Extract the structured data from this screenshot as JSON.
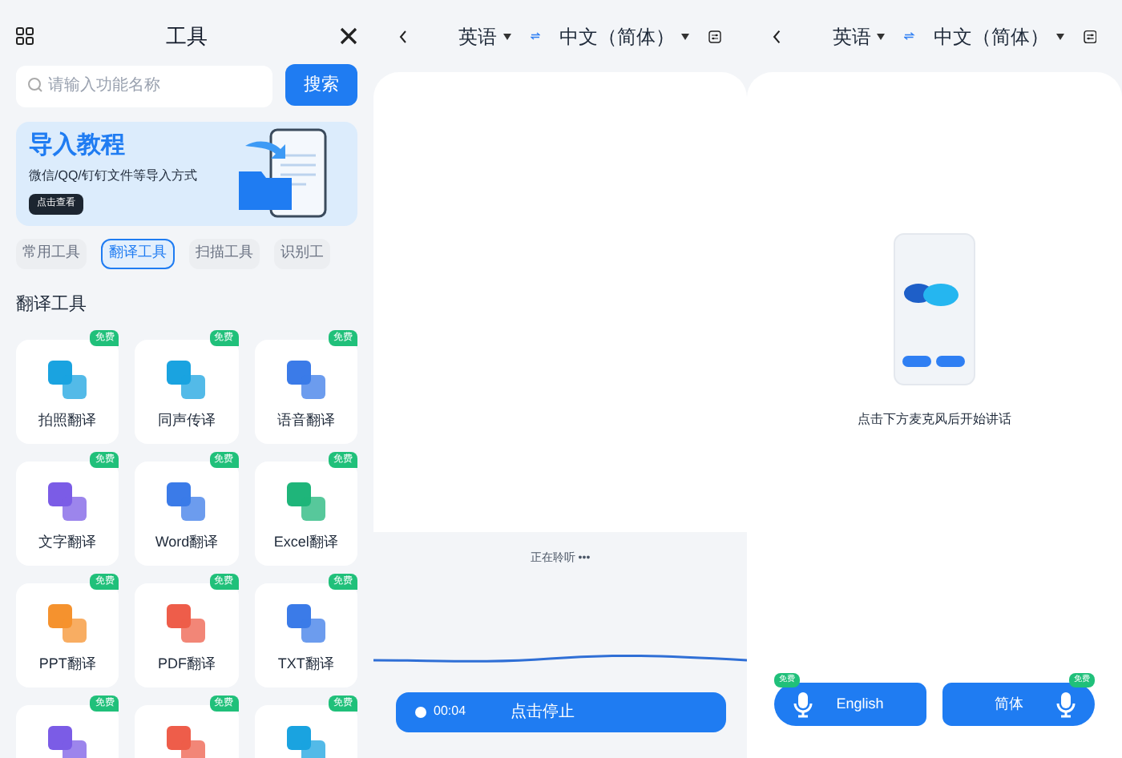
{
  "tools_panel": {
    "title": "工具",
    "search": {
      "placeholder": "请输入功能名称",
      "button": "搜索"
    },
    "banner": {
      "title": "导入教程",
      "subtitle": "微信/QQ/钉钉文件等导入方式",
      "button": "点击查看"
    },
    "categories": [
      {
        "label": "常用工具",
        "selected": false
      },
      {
        "label": "翻译工具",
        "selected": true
      },
      {
        "label": "扫描工具",
        "selected": false
      },
      {
        "label": "识别工",
        "selected": false
      }
    ],
    "section_title": "翻译工具",
    "tools": [
      {
        "name": "拍照翻译",
        "badge": "免费",
        "color": "#1aa3e0"
      },
      {
        "name": "同声传译",
        "badge": "免费",
        "color": "#1aa3e0"
      },
      {
        "name": "语音翻译",
        "badge": "免费",
        "color": "#3b7be8"
      },
      {
        "name": "文字翻译",
        "badge": "免费",
        "color": "#7b5ce6"
      },
      {
        "name": "Word翻译",
        "badge": "免费",
        "color": "#3b7be8"
      },
      {
        "name": "Excel翻译",
        "badge": "免费",
        "color": "#1fb57a"
      },
      {
        "name": "PPT翻译",
        "badge": "免费",
        "color": "#f5922e"
      },
      {
        "name": "PDF翻译",
        "badge": "免费",
        "color": "#ee5d4a"
      },
      {
        "name": "TXT翻译",
        "badge": "免费",
        "color": "#3b7be8"
      },
      {
        "badge": "免费",
        "color": "#7b5ce6"
      },
      {
        "badge": "免费",
        "color": "#ee5d4a"
      },
      {
        "badge": "免费",
        "color": "#1aa3e0"
      }
    ]
  },
  "listening_panel": {
    "source_lang": "英语",
    "target_lang": "中文（简体）",
    "status": "正在聆听 •••",
    "recording": {
      "time": "00:04",
      "stop_button": "点击停止"
    }
  },
  "ready_panel": {
    "source_lang": "英语",
    "target_lang": "中文（简体）",
    "hint": "点击下方麦克风后开始讲话",
    "mic_buttons": [
      {
        "label": "English",
        "badge": "免费",
        "kind": "micleft"
      },
      {
        "label": "简体",
        "badge": "免费",
        "kind": "micright"
      }
    ]
  }
}
